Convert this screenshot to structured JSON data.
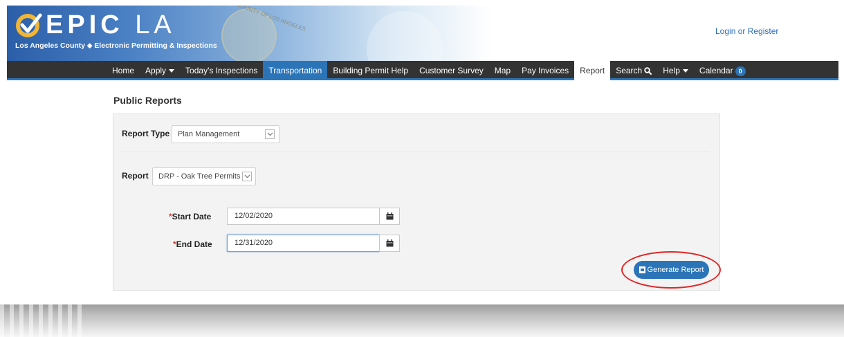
{
  "header": {
    "logo_main": "EPIC",
    "logo_la": "LA",
    "logo_subtitle": "Los Angeles County ⬥ Electronic Permitting & Inspections",
    "seal_text": "COUNTY OF LOS ANGELES",
    "login_label": "Login or Register"
  },
  "nav": {
    "items": [
      {
        "label": "Home"
      },
      {
        "label": "Apply"
      },
      {
        "label": "Today's Inspections"
      },
      {
        "label": "Transportation"
      },
      {
        "label": "Building Permit Help"
      },
      {
        "label": "Customer Survey"
      },
      {
        "label": "Map"
      },
      {
        "label": "Pay Invoices"
      },
      {
        "label": "Report"
      },
      {
        "label": "Search"
      },
      {
        "label": "Help"
      },
      {
        "label": "Calendar"
      }
    ],
    "calendar_badge": "0"
  },
  "main": {
    "title": "Public Reports",
    "report_type_label": "Report Type",
    "report_type_value": "Plan Management",
    "report_label": "Report",
    "report_value": "DRP - Oak Tree Permits I",
    "start_date_label": "Start Date",
    "start_date_value": "12/02/2020",
    "end_date_label": "End Date",
    "end_date_value": "12/31/2020",
    "required_marker": "*",
    "generate_label": "Generate Report"
  },
  "colors": {
    "accent": "#2c74b8",
    "navbar": "#333333",
    "highlight_circle": "#e32424",
    "required": "#d9372b"
  },
  "icons": [
    "check-logo-icon",
    "county-seal-icon",
    "caret-down-icon",
    "search-icon",
    "chevron-down-icon",
    "calendar-icon",
    "pdf-icon"
  ]
}
